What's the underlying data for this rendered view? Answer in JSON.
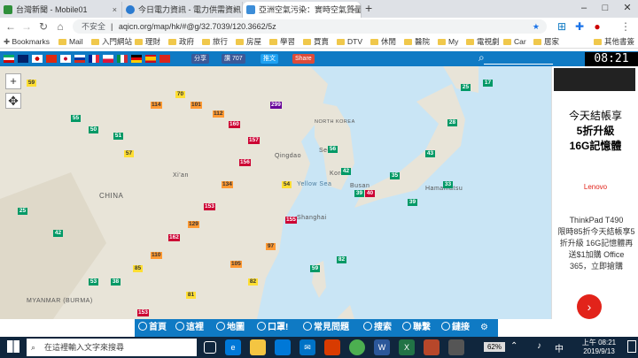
{
  "browser": {
    "tabs": [
      {
        "title": "台灣新聞 - Mobile01",
        "color": "#2f8f3b"
      },
      {
        "title": "今日電力資訊 - 電力供需資訊 - 台...",
        "color": "#2b7bd0"
      },
      {
        "title": "亞洲空氣污染：實時空氣質量指數地...",
        "color": "#3c8dd8"
      }
    ],
    "new_tab": "+",
    "insecure_label": "不安全",
    "url": "aqicn.org/map/hk/#@g/32.7039/120.3662/5z",
    "bookmarks": [
      "Bookmarks",
      "Mail",
      "入門網站",
      "理財",
      "政府",
      "旅行",
      "房屋",
      "學習",
      "買賣",
      "DTV",
      "休閒",
      "醫院",
      "My",
      "電視劇",
      "Car",
      "居家",
      "其他書簽"
    ]
  },
  "site": {
    "share_buttons": [
      {
        "label": "分享",
        "color": "#3b5998"
      },
      {
        "label": "讚 707",
        "color": "#3b5998"
      },
      {
        "label": "推文",
        "color": "#1da1f2"
      },
      {
        "label": "Share",
        "color": "#dd4b39"
      }
    ],
    "clock": "08:21",
    "zoom_in": "+",
    "zoom_out": "−",
    "map_labels": [
      "CHINA",
      "NORTH KOREA",
      "Korea",
      "Seoul",
      "Yellow Sea",
      "MYANMAR (BURMA)",
      "Qingdao",
      "Xi'an",
      "Hamamatsu",
      "Shanghai",
      "Busan"
    ],
    "nav": [
      "首頁",
      "這裡",
      "地圖",
      "口罩!",
      "常見問題",
      "搜索",
      "聯繫",
      "鏈接"
    ]
  },
  "ad": {
    "headline1": "今天結帳享",
    "headline2": "5折升級",
    "headline3": "16G記憶體",
    "brand": "Lenovo",
    "model": "ThinkPad T490",
    "body": "限時85折今天結帳享5折升級 16G記憶體再送$1加購 Office 365，立即搶購"
  },
  "taskbar": {
    "search_placeholder": "在這裡輸入文字來搜尋",
    "battery": "62%",
    "time_period": "上午 08:21",
    "date": "2019/9/13"
  }
}
